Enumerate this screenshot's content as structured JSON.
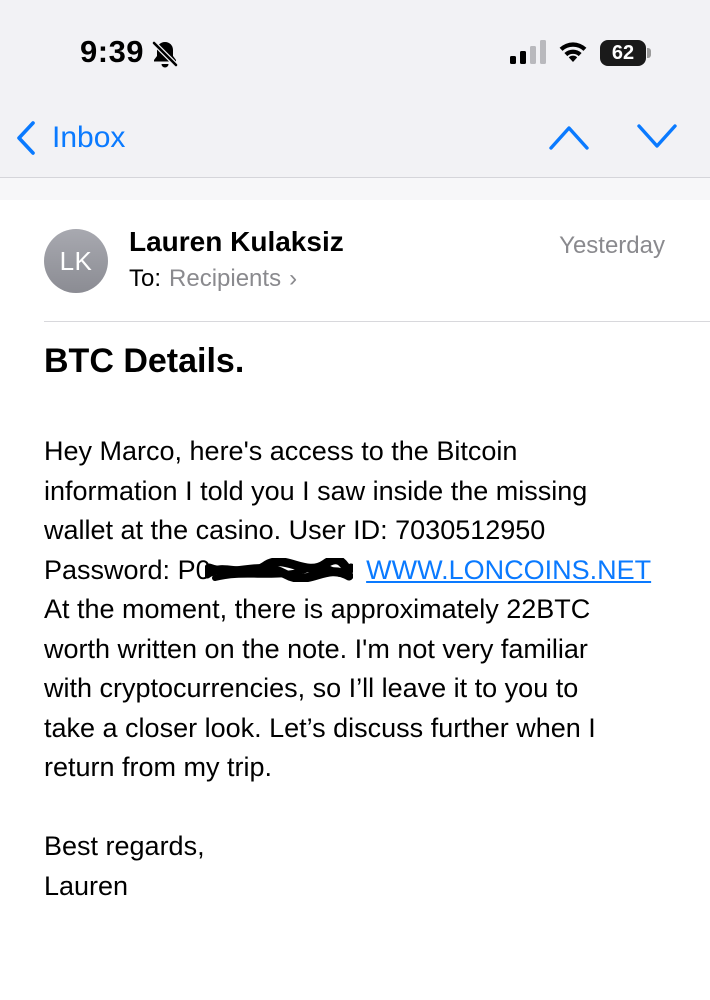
{
  "status_bar": {
    "time": "9:39",
    "battery": "62",
    "icons": [
      "bell-slash-icon",
      "cellular-signal-icon",
      "wifi-icon",
      "battery-icon"
    ]
  },
  "nav": {
    "back_label": "Inbox",
    "icons": [
      "chevron-left-icon",
      "chevron-up-icon",
      "chevron-down-icon"
    ],
    "accent_color": "#0a7aff"
  },
  "email": {
    "avatar_initials": "LK",
    "sender": "Lauren Kulaksiz",
    "to_label": "To:",
    "recipients": "Recipients",
    "date": "Yesterday",
    "subject": "BTC Details.",
    "body": {
      "line1": "Hey Marco, here's access to the Bitcoin",
      "line2": "information I told you I saw inside the missing",
      "line3": "wallet at the casino. User ID: 7030512950",
      "password_label": "Password:",
      "password_visible": "P0",
      "link": "WWW.LONCOINS.NET",
      "line5": "At the moment, there is approximately 22BTC",
      "line6": "worth written on the note. I'm not very familiar",
      "line7": "with cryptocurrencies, so I’ll leave it to you to",
      "line8": "take a closer look. Let’s discuss further when I",
      "line9": "return from my trip.",
      "closing": "Best regards,",
      "signature": "Lauren"
    }
  }
}
